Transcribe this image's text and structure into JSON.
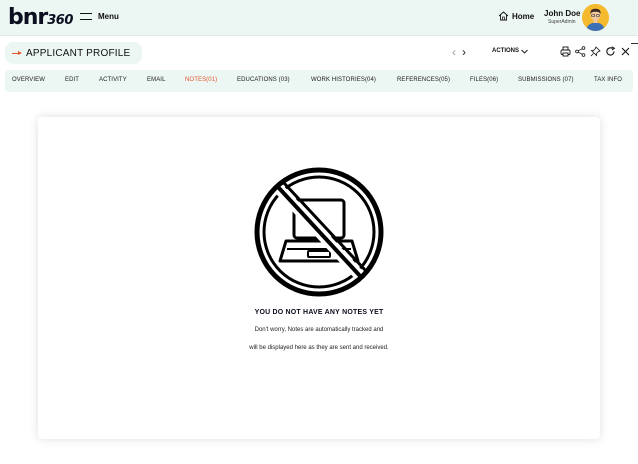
{
  "header": {
    "logo_main": "bnr",
    "logo_sub": "360",
    "menu_label": "Menu",
    "home_label": "Home",
    "user_name": "John Doe",
    "user_role": "SuperAdmin"
  },
  "profile_bar": {
    "title": "APPLICANT PROFILE",
    "actions_label": "ACTIONS",
    "prev_glyph": "‹",
    "next_glyph": "›"
  },
  "tabs": [
    {
      "label": "OVERVIEW",
      "active": false
    },
    {
      "label": "EDIT",
      "active": false
    },
    {
      "label": "ACTIVITY",
      "active": false
    },
    {
      "label": "EMAIL",
      "active": false
    },
    {
      "label": "NOTES(01)",
      "active": true
    },
    {
      "label": "EDUCATIONS (03)",
      "active": false
    },
    {
      "label": "WORK HISTORIES(04)",
      "active": false
    },
    {
      "label": "REFERENCES(05)",
      "active": false
    },
    {
      "label": "FILES(06)",
      "active": false
    },
    {
      "label": "SUBMISSIONS (07)",
      "active": false
    },
    {
      "label": "TAX INFO",
      "active": false
    }
  ],
  "empty_state": {
    "title": "YOU DO NOT HAVE ANY NOTES YET",
    "line1": "Don't worry, Notes are automatically tracked and",
    "line2": "will be displayed here as they are sent and received.",
    "icon": "no-laptop-icon"
  },
  "colors": {
    "accent": "#e4572e",
    "header_bg": "#ecf6f3",
    "avatar_bg": "#f5b92e"
  },
  "icons": [
    "hamburger-icon",
    "home-icon",
    "avatar",
    "arrow-right-icon",
    "chevron-left-icon",
    "chevron-right-icon",
    "chevron-down-icon",
    "print-icon",
    "share-icon",
    "pin-icon",
    "refresh-icon",
    "close-icon",
    "no-laptop-icon"
  ]
}
